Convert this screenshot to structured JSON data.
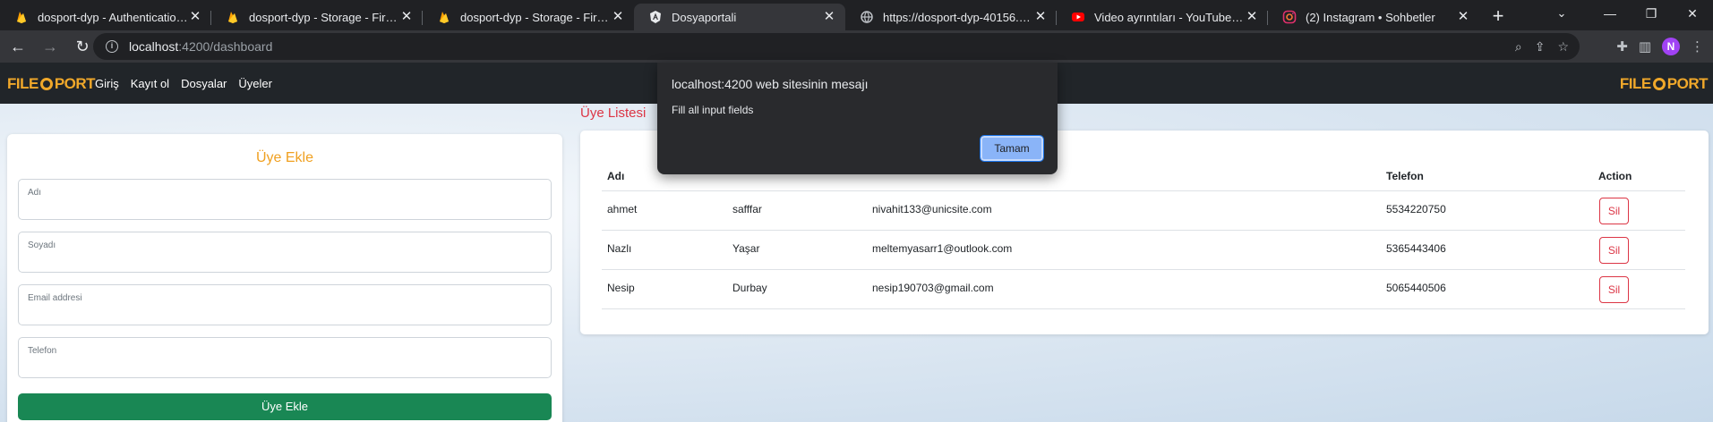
{
  "browser": {
    "tabs": [
      {
        "title": "dosport-dyp - Authentication - F",
        "icon": "firebase-icon",
        "active": false
      },
      {
        "title": "dosport-dyp - Storage - Firebase",
        "icon": "firebase-icon",
        "active": false
      },
      {
        "title": "dosport-dyp - Storage - Firebase",
        "icon": "firebase-icon",
        "active": false
      },
      {
        "title": "Dosyaportali",
        "icon": "angular-icon",
        "active": true
      },
      {
        "title": "https://dosport-dyp-40156.fireb",
        "icon": "globe-icon",
        "active": false
      },
      {
        "title": "Video ayrıntıları - YouTube Studi",
        "icon": "youtube-icon",
        "active": false
      },
      {
        "title": "(2) Instagram • Sohbetler",
        "icon": "instagram-icon",
        "active": false
      }
    ],
    "url_host": "localhost",
    "url_path": ":4200/dashboard",
    "profile_initial": "N"
  },
  "app": {
    "logo_left": "FILE",
    "logo_right": "PORT",
    "nav": [
      "Giriş",
      "Kayıt ol",
      "Dosyalar",
      "Üyeler"
    ]
  },
  "form": {
    "title": "Üye Ekle",
    "fields": [
      {
        "label": "Adı"
      },
      {
        "label": "Soyadı"
      },
      {
        "label": "Email addresi"
      },
      {
        "label": "Telefon"
      }
    ],
    "submit_label": "Üye Ekle"
  },
  "members": {
    "title": "Üye Listesi",
    "headers": [
      "Adı",
      "",
      "",
      "Telefon",
      "Action"
    ],
    "rows": [
      {
        "ad": "ahmet",
        "soyad": "safffar",
        "email": "nivahit133@unicsite.com",
        "telefon": "5534220750"
      },
      {
        "ad": "Nazlı",
        "soyad": "Yaşar",
        "email": "meltemyasarr1@outlook.com",
        "telefon": "5365443406"
      },
      {
        "ad": "Nesip",
        "soyad": "Durbay",
        "email": "nesip190703@gmail.com",
        "telefon": "5065440506"
      }
    ],
    "delete_label": "Sil"
  },
  "dialog": {
    "title": "localhost:4200 web sitesinin mesajı",
    "message": "Fill all input fields",
    "ok_label": "Tamam"
  },
  "colors": {
    "accent_orange": "#f0a020",
    "danger_red": "#dc3545",
    "success_green": "#198754",
    "nav_dark": "#212529"
  }
}
